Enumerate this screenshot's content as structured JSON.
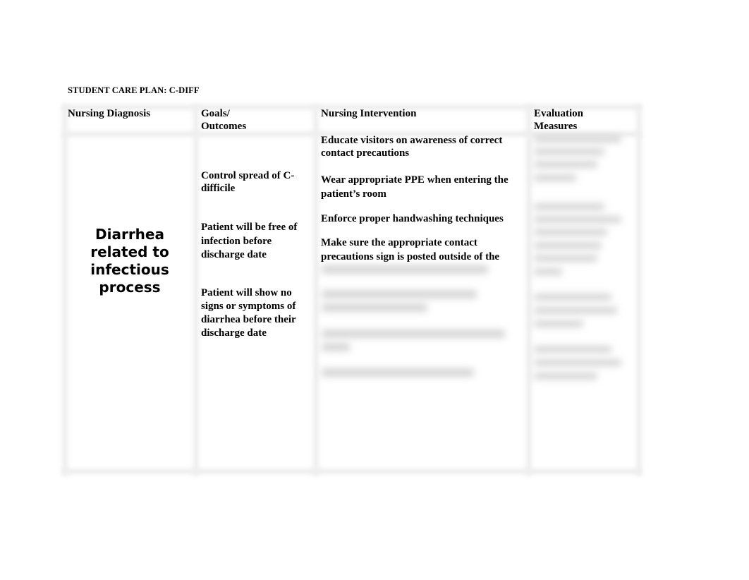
{
  "document": {
    "title": "STUDENT CARE PLAN: C-DIFF"
  },
  "table": {
    "headers": {
      "diagnosis": "Nursing Diagnosis",
      "goals_line1": "Goals/",
      "goals_line2": "Outcomes",
      "intervention": "Nursing Intervention",
      "evaluation_line1": "Evaluation",
      "evaluation_line2": "Measures"
    },
    "diagnosis": "Diarrhea related to infectious process",
    "goals": [
      "Control spread of C-difficile",
      "Patient will be free of infection before discharge date",
      "Patient will show no signs or symptoms of diarrhea before their discharge date"
    ],
    "interventions": [
      "Educate visitors on awareness of correct contact precautions",
      "Wear appropriate PPE when entering the patient’s room",
      "Enforce proper handwashing techniques",
      "Make sure the appropriate contact precautions sign is posted outside of the"
    ],
    "blurred_content_note": "remaining interventions and evaluation measures are obscured"
  }
}
